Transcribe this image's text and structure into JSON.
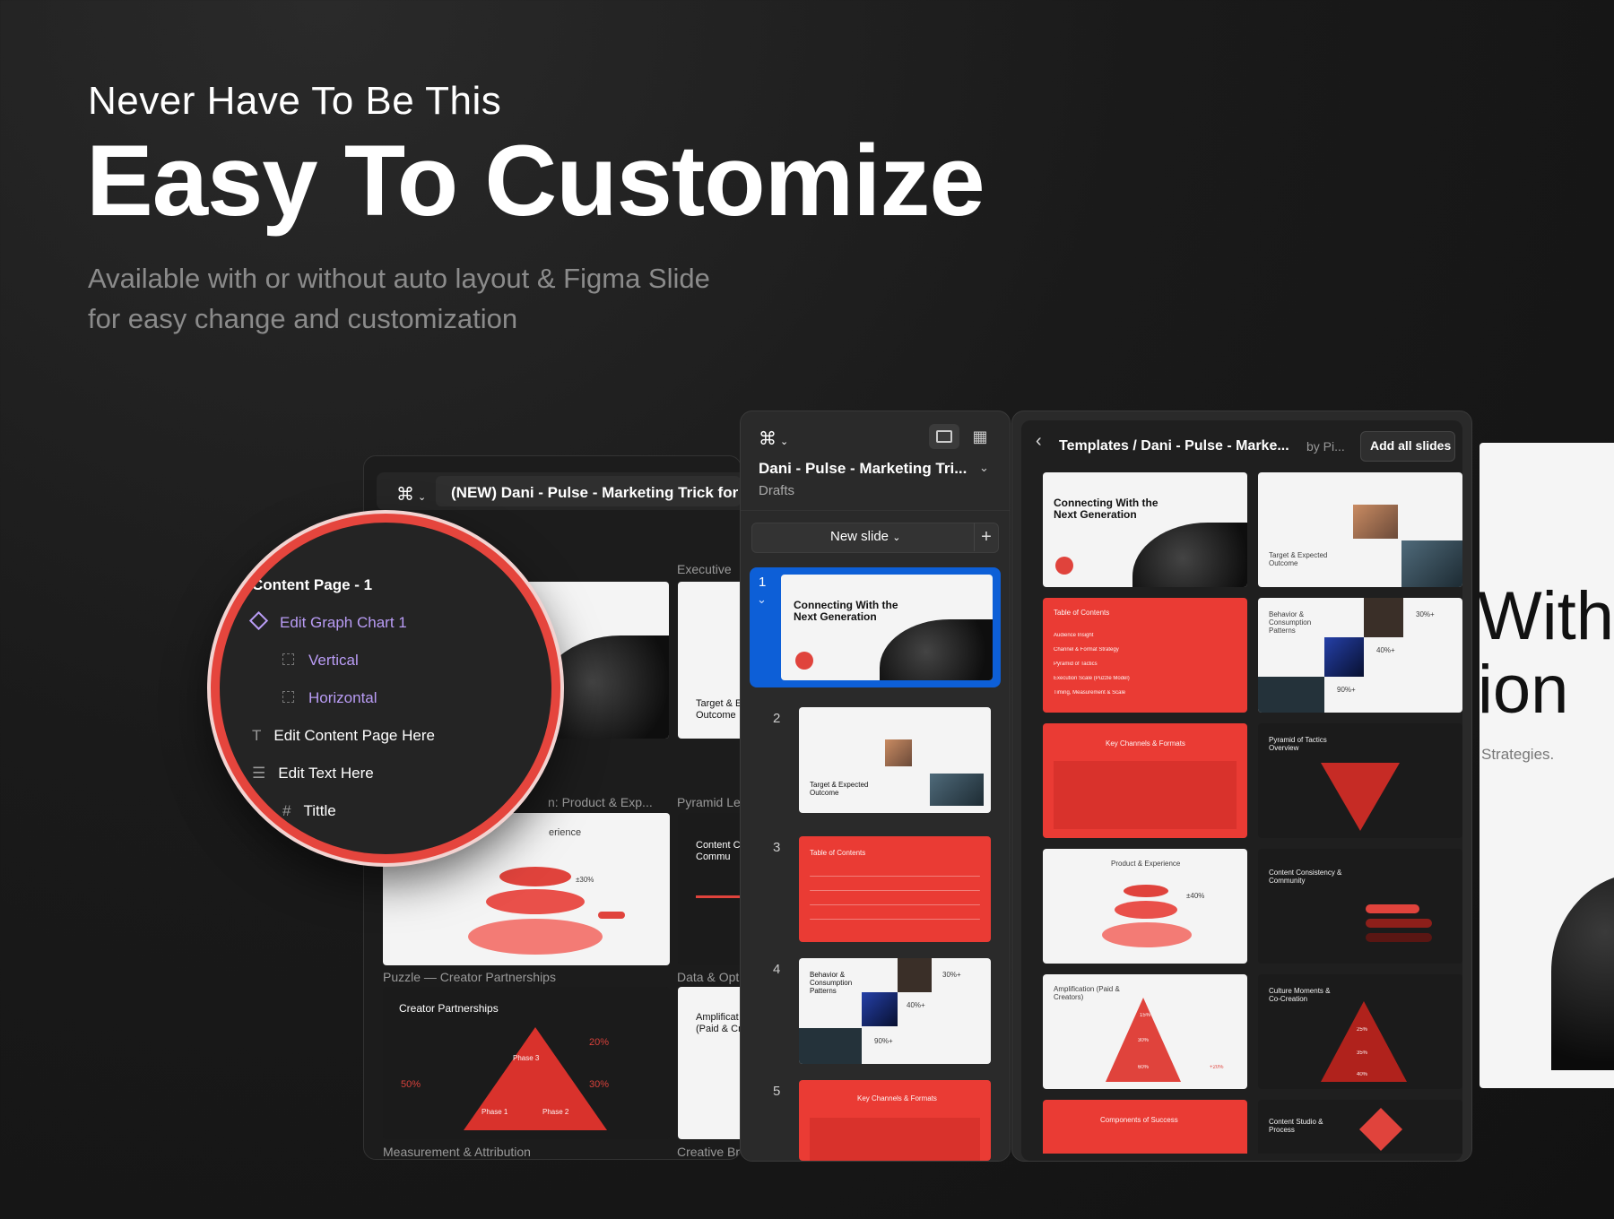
{
  "hero": {
    "pre_title": "Never Have To Be This",
    "title": "Easy To Customize",
    "subtitle_line1": "Available with or without auto layout  & Figma Slide",
    "subtitle_line2": "for easy change and customization"
  },
  "left_window": {
    "file_name": "(NEW) Dani - Pulse - Marketing Trick for N",
    "frame_labels": [
      "Executive",
      "n: Product & Exp...",
      "Pyramid Le",
      "Puzzle — Creator Partnerships",
      "Data & Opt",
      "Measurement & Attribution",
      "Creative Brie"
    ],
    "slides": {
      "target_outcome": "Target & Expected Outcome",
      "target_short": "Target & E Outcome",
      "content_c": "Content C & Commu",
      "experience": "erience",
      "creator_partnerships": "Creator Partnerships",
      "amplification_short": "Amplificat (Paid & Cr",
      "pct_30": "±30%",
      "pct_20": "20%",
      "pct_50": "50%",
      "pct_30b": "30%",
      "phase1": "Phase 1",
      "phase2": "Phase 2",
      "phase3": "Phase 3"
    }
  },
  "layers_panel": {
    "items": [
      {
        "label": "Content Page - 1",
        "icon": "frame-icon"
      },
      {
        "label": "Edit Graph Chart 1",
        "icon": "component-icon"
      },
      {
        "label": "Vertical",
        "icon": "frame-dashed-icon"
      },
      {
        "label": "Horizontal",
        "icon": "frame-dashed-icon"
      },
      {
        "label": "Edit Content Page Here",
        "icon": "text-icon"
      },
      {
        "label": "Edit Text Here",
        "icon": "autolayout-icon"
      },
      {
        "label": "Tittle",
        "icon": "frame-icon"
      }
    ]
  },
  "middle_panel": {
    "project_title": "Dani - Pulse - Marketing Tri...",
    "project_location": "Drafts",
    "new_slide_label": "New slide",
    "slides": [
      {
        "number": "1",
        "title": "Connecting With the Next Generation"
      },
      {
        "number": "2",
        "title": "Target & Expected Outcome"
      },
      {
        "number": "3",
        "title": "Table of Contents"
      },
      {
        "number": "4",
        "title": "Behavior & Consumption Patterns",
        "stats": [
          "30%+",
          "40%+",
          "90%+"
        ]
      },
      {
        "number": "5",
        "title": "Key Channels & Formats"
      }
    ]
  },
  "templates_panel": {
    "breadcrumb": "Templates / Dani - Pulse - Marke...",
    "author": "by Pi...",
    "add_all_label": "Add all slides",
    "grid": [
      {
        "title": "Connecting With the Next Generation",
        "theme": "light"
      },
      {
        "title": "Target & Expected Outcome",
        "theme": "light"
      },
      {
        "title": "Table of Contents",
        "theme": "red",
        "rows": [
          "Audience Insight",
          "Channel & Format Strategy",
          "Pyramid of Tactics",
          "Execution Scale (Puzzle Model)",
          "Timing, Measurement & Scale"
        ]
      },
      {
        "title": "Behavior & Consumption Patterns",
        "theme": "light",
        "stats": [
          "30%+",
          "40%+",
          "90%+"
        ]
      },
      {
        "title": "Key Channels & Formats",
        "theme": "red"
      },
      {
        "title": "Pyramid of Tactics Overview",
        "theme": "dark"
      },
      {
        "title": "Product & Experience",
        "theme": "light",
        "stat": "±40%"
      },
      {
        "title": "Content Consistency & Community",
        "theme": "dark"
      },
      {
        "title": "Amplification (Paid & Creators)",
        "theme": "light",
        "stats": [
          "15%",
          "30%",
          "60%",
          "+20%"
        ]
      },
      {
        "title": "Culture Moments & Co-Creation",
        "theme": "dark",
        "stats": [
          "25%",
          "35%",
          "40%"
        ]
      },
      {
        "title": "Components of Success",
        "theme": "red"
      },
      {
        "title": "Content Studio & Process",
        "theme": "dark"
      }
    ]
  },
  "right_preview": {
    "line1": "With t",
    "line2": "ion",
    "caption": "Strategies."
  },
  "colors": {
    "accent_red": "#EA3B34",
    "selection_blue": "#0D5FD7",
    "layer_purple": "#B99CF5"
  }
}
